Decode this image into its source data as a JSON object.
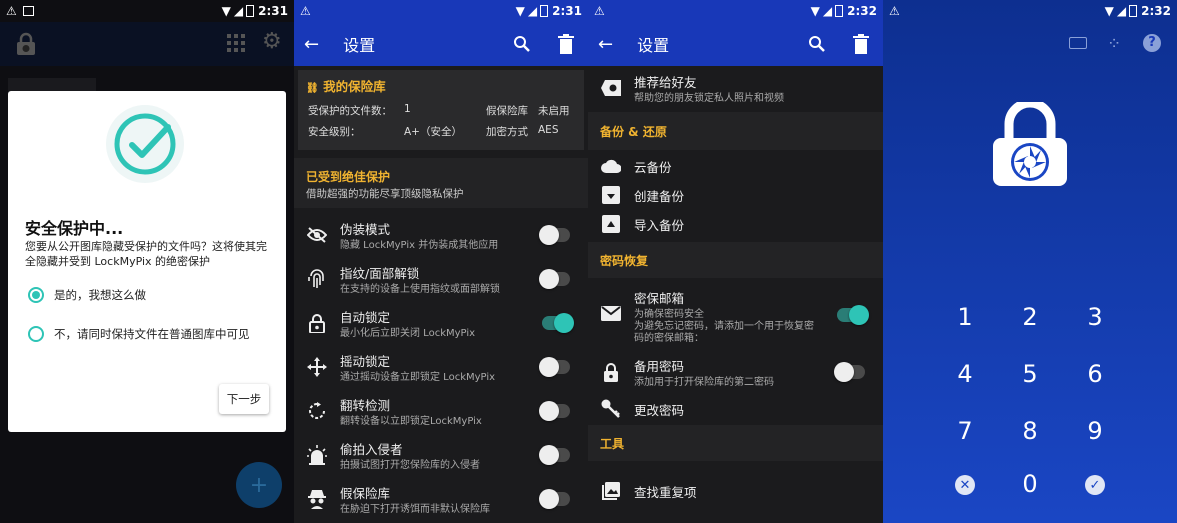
{
  "status": {
    "time1": "2:31",
    "time2": "2:31",
    "time3": "2:32",
    "time4": "2:32"
  },
  "dialog": {
    "title": "安全保护中...",
    "message": "您要从公开图库隐藏受保护的文件吗？这将使其完全隐藏并受到 LockMyPix 的绝密保护",
    "option_yes": "是的，我想这么做",
    "option_no": "不，请同时保持文件在普通图库中可见",
    "next": "下一步"
  },
  "settings1": {
    "title": "设置",
    "vault": {
      "header": "我的保险库",
      "protected_files_label": "受保护的文件数：",
      "protected_files_value": "1",
      "fake_vault_label": "假保险库",
      "fake_vault_value": "未启用",
      "security_label": "安全级别：",
      "security_value": "A+（安全）",
      "encryption_label": "加密方式",
      "encryption_value": "AES"
    },
    "premium": {
      "title": "已受到绝佳保护",
      "subtitle": "借助超强的功能尽享顶级隐私保护"
    },
    "items": [
      {
        "title": "伪装模式",
        "subtitle": "隐藏 LockMyPix 并伪装成其他应用",
        "on": false,
        "icon": "eye-off-icon"
      },
      {
        "title": "指纹/面部解锁",
        "subtitle": "在支持的设备上使用指纹或面部解锁",
        "on": false,
        "icon": "fingerprint-icon"
      },
      {
        "title": "自动锁定",
        "subtitle": "最小化后立即关闭 LockMyPix",
        "on": true,
        "icon": "lock-icon"
      },
      {
        "title": "摇动锁定",
        "subtitle": "通过摇动设备立即锁定 LockMyPix",
        "on": false,
        "icon": "move-icon"
      },
      {
        "title": "翻转检测",
        "subtitle": "翻转设备以立即锁定LockMyPix",
        "on": false,
        "icon": "rotate-icon"
      },
      {
        "title": "偷拍入侵者",
        "subtitle": "拍摄试图打开您保险库的入侵者",
        "on": false,
        "icon": "alarm-icon"
      },
      {
        "title": "假保险库",
        "subtitle": "在胁迫下打开诱饵而非默认保险库",
        "on": false,
        "icon": "spy-icon"
      }
    ]
  },
  "settings2": {
    "title": "设置",
    "recommend": {
      "title": "推荐给好友",
      "subtitle": "帮助您的朋友锁定私人照片和视频"
    },
    "backup_header": "备份 & 还原",
    "cloud_backup": "云备份",
    "create_backup": "创建备份",
    "import_backup": "导入备份",
    "recovery_header": "密码恢复",
    "email": {
      "title": "密保邮箱",
      "subtitle": "为确保密码安全\n为避免忘记密码，请添加一个用于恢复密码的密保邮箱：",
      "on": true
    },
    "backup_pw": {
      "title": "备用密码",
      "subtitle": "添加用于打开保险库的第二密码",
      "on": false
    },
    "change_pw": "更改密码",
    "tools_header": "工具",
    "find_dupes": "查找重复项"
  },
  "keypad": {
    "keys": [
      "1",
      "2",
      "3",
      "4",
      "5",
      "6",
      "7",
      "8",
      "9",
      "0"
    ]
  },
  "colors": {
    "accent": "#2ec4b6",
    "yellow": "#f0b330",
    "blue_bar": "#1838b8"
  }
}
